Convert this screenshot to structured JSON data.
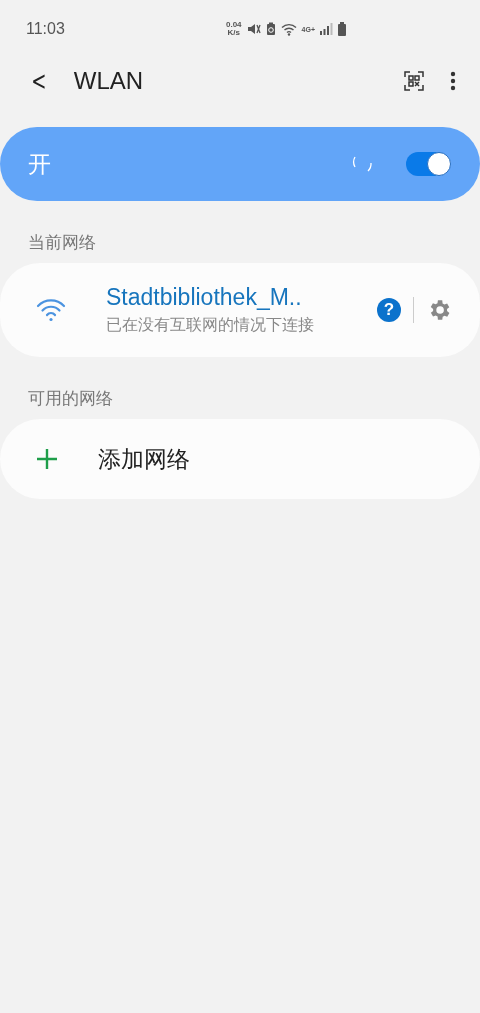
{
  "status_bar": {
    "time": "11:03",
    "speed_value": "0.04",
    "speed_unit": "K/s",
    "network_type": "4G+"
  },
  "app_bar": {
    "back_glyph": "<",
    "title": "WLAN"
  },
  "master_switch": {
    "label": "开",
    "on": true,
    "scanning": true
  },
  "sections": [
    {
      "header": "当前网络",
      "items": [
        {
          "kind": "network",
          "name": "Stadtbibliothek_M..",
          "status": "已在没有互联网的情况下连接",
          "help_glyph": "?"
        }
      ]
    },
    {
      "header": "可用的网络",
      "items": [
        {
          "kind": "add",
          "label": "添加网络"
        }
      ]
    }
  ]
}
